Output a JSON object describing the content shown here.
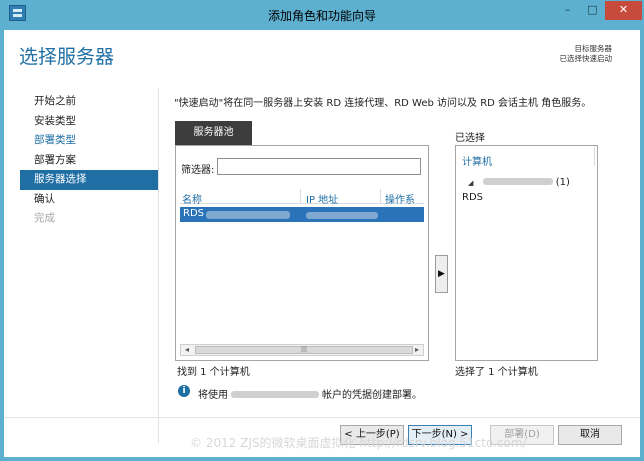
{
  "window": {
    "title": "添加角色和功能向导"
  },
  "page": {
    "title": "选择服务器",
    "destination_label": "目标服务器",
    "destination_value": "已选择快速启动"
  },
  "nav": {
    "items": [
      {
        "label": "开始之前"
      },
      {
        "label": "安装类型"
      },
      {
        "label": "部署类型"
      },
      {
        "label": "部署方案"
      },
      {
        "label": "服务器选择"
      },
      {
        "label": "确认"
      },
      {
        "label": "完成"
      }
    ]
  },
  "main": {
    "description": "\"快速启动\"将在同一服务器上安装 RD 连接代理、RD Web 访问以及 RD 会话主机 角色服务。",
    "tab_label": "服务器池",
    "filter_label": "筛选器:",
    "filter_value": "",
    "columns": [
      "名称",
      "IP 地址",
      "操作系统"
    ],
    "rows": [
      {
        "name": "RDS"
      }
    ],
    "count_left": "找到 1 个计算机",
    "add_arrow": "▶",
    "selected_label": "已选择",
    "selected_column": "计算机",
    "selected_node_suffix": "(1)",
    "selected_role": "RDS",
    "count_right": "选择了 1 个计算机",
    "info_prefix": "将使用",
    "info_suffix": "帐户的凭据创建部署。"
  },
  "buttons": {
    "prev": "< 上一步(P)",
    "next": "下一步(N) >",
    "deploy": "部署(D)",
    "cancel": "取消"
  },
  "watermark": "© 2012 ZJS的微软桌面虚拟化 http://rdsrv.blog.51cto.com/",
  "colors": {
    "accent": "#1f6fa5",
    "titlebar": "#5db0cf",
    "selection": "#2a73b8"
  }
}
